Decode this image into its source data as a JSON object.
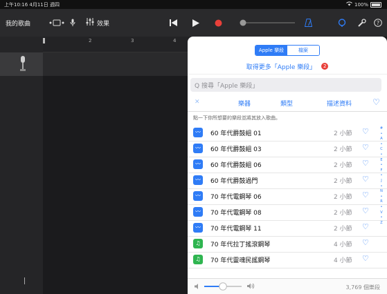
{
  "status": {
    "time": "上午10:16  4月11日 週四",
    "battery": "100%"
  },
  "toolbar": {
    "my_songs": "我的歌曲",
    "fx": "效果"
  },
  "ruler": [
    "2",
    "3",
    "4"
  ],
  "panel": {
    "segments": [
      {
        "label": "Apple 樂段",
        "active": true
      },
      {
        "label": "檔案",
        "active": false
      }
    ],
    "more": "取得更多「Apple 樂段」",
    "more_badge": "2",
    "search_placeholder": "Q 搜尋「Apple 樂段」",
    "filters": {
      "close": "✕",
      "instruments": "樂器",
      "genre": "類型",
      "descriptors": "描述資料",
      "fav": "♡"
    },
    "hint": "點一下你所想要的樂段並將其放入歌曲。",
    "loops": [
      {
        "name": "60 年代爵鼓組 01",
        "bars": "2 小節",
        "kind": "audio",
        "color": "#2f7cf6",
        "icon": "waveform-icon"
      },
      {
        "name": "60 年代爵鼓組 03",
        "bars": "2 小節",
        "kind": "audio",
        "color": "#2f7cf6",
        "icon": "waveform-icon"
      },
      {
        "name": "60 年代爵鼓組 06",
        "bars": "2 小節",
        "kind": "audio",
        "color": "#2f7cf6",
        "icon": "waveform-icon"
      },
      {
        "name": "60 年代爵鼓過門",
        "bars": "2 小節",
        "kind": "audio",
        "color": "#2f7cf6",
        "icon": "waveform-icon"
      },
      {
        "name": "70 年代電鋼琴 06",
        "bars": "2 小節",
        "kind": "audio",
        "color": "#2f7cf6",
        "icon": "waveform-icon"
      },
      {
        "name": "70 年代電鋼琴 08",
        "bars": "2 小節",
        "kind": "audio",
        "color": "#2f7cf6",
        "icon": "waveform-icon"
      },
      {
        "name": "70 年代電鋼琴 11",
        "bars": "2 小節",
        "kind": "audio",
        "color": "#2f7cf6",
        "icon": "waveform-icon"
      },
      {
        "name": "70 年代拉丁搖滾鋼琴",
        "bars": "4 小節",
        "kind": "midi",
        "color": "#2fb550",
        "icon": "music-note-icon"
      },
      {
        "name": "70 年代靈魂民謠鋼琴",
        "bars": "4 小節",
        "kind": "midi",
        "color": "#2fb550",
        "icon": "music-note-icon"
      }
    ],
    "alpha_index": [
      "#",
      "A",
      "C",
      "E",
      "F",
      "J",
      "N",
      "R",
      "V",
      "Z"
    ],
    "count": "3,769 個樂段"
  },
  "colors": {
    "accent": "#2f7cf6",
    "record": "#e8403a"
  }
}
